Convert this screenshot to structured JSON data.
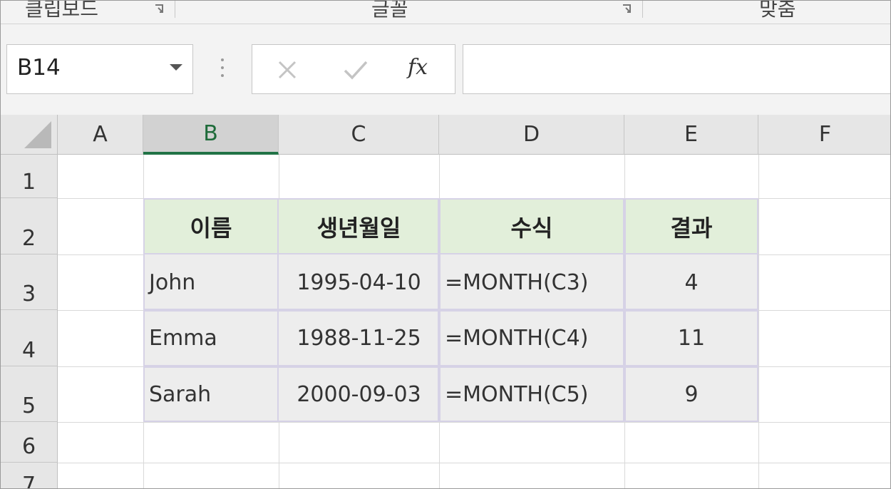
{
  "ribbon": {
    "groups": [
      "클립보드",
      "글꼴",
      "맞춤"
    ]
  },
  "formula_bar": {
    "name_box": "B14",
    "cancel_icon": "x-icon",
    "enter_icon": "checkmark-icon",
    "fx_label": "fx",
    "formula": ""
  },
  "sheet": {
    "columns": [
      "A",
      "B",
      "C",
      "D",
      "E",
      "F"
    ],
    "selected_column": "B",
    "rows": [
      "1",
      "2",
      "3",
      "4",
      "5",
      "6",
      "7"
    ],
    "table": {
      "headers": [
        "이름",
        "생년월일",
        "수식",
        "결과"
      ],
      "rows": [
        [
          "John",
          "1995-04-10",
          "=MONTH(C3)",
          "4"
        ],
        [
          "Emma",
          "1988-11-25",
          "=MONTH(C4)",
          "11"
        ],
        [
          "Sarah",
          "2000-09-03",
          "=MONTH(C5)",
          "9"
        ]
      ]
    },
    "colors": {
      "header_fill": "#e2efda",
      "body_fill": "#ededed",
      "selection_accent": "#217346"
    }
  }
}
